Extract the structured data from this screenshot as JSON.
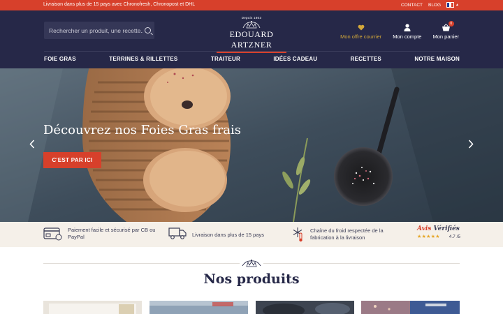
{
  "topbar": {
    "promo": "Livraison dans plus de 15 pays avec Chronofresh, Chronopost et DHL",
    "contact": "CONTACT",
    "blog": "BLOG",
    "flag_colors": [
      "#1f3f9a",
      "#ffffff",
      "#d7402b"
    ]
  },
  "header": {
    "search_placeholder": "Rechercher un produit, une recette...",
    "logo_since": "Depuis 1803",
    "logo_name": "EDOUARD ARTZNER",
    "actions": [
      {
        "label": "Mon offre courrier",
        "icon": "heart-icon"
      },
      {
        "label": "Mon compte",
        "icon": "user-icon"
      },
      {
        "label": "Mon panier",
        "icon": "basket-icon",
        "badge": "0"
      }
    ]
  },
  "nav": [
    "FOIE GRAS",
    "TERRINES & RILLETTES",
    "TRAITEUR",
    "IDÉES CADEAU",
    "RECETTES",
    "NOTRE MAISON"
  ],
  "hero": {
    "title": "Découvrez nos Foies Gras frais",
    "cta": "C'EST PAR ICI"
  },
  "reassurance": [
    {
      "text": "Paiement facile et sécurisé par CB ou PayPal",
      "icon": "credit-card-icon"
    },
    {
      "text": "Livraison dans plus de 15 pays",
      "icon": "delivery-truck-icon"
    },
    {
      "text": "Chaîne du froid respectée de la fabrication à la livraison",
      "icon": "snowflake-thermometer-icon"
    }
  ],
  "avis": {
    "brand_a": "Avis",
    "brand_b": "Vérifiés",
    "stars": "★★★★★",
    "score": "4.7 /5"
  },
  "products": {
    "title": "Nos produits"
  },
  "colors": {
    "brand_navy": "#262848",
    "accent_red": "#d7402b",
    "gold": "#d3a83a",
    "cream": "#f5f0e9"
  }
}
